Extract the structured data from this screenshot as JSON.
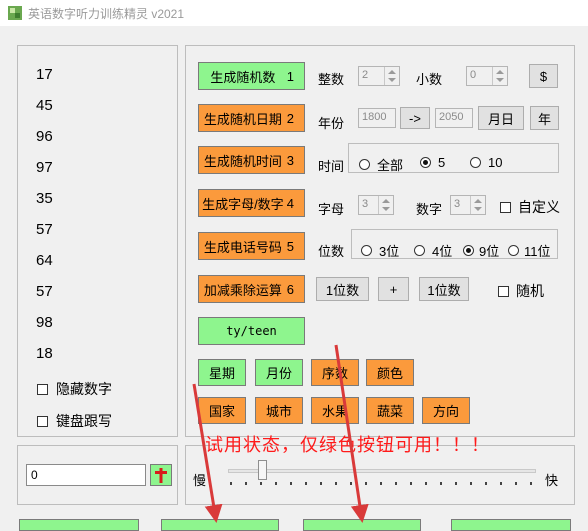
{
  "window": {
    "title": "英语数字听力训练精灵 v2021"
  },
  "numbers": [
    "17",
    "45",
    "96",
    "97",
    "35",
    "57",
    "64",
    "57",
    "98",
    "18"
  ],
  "left_options": {
    "hide_numbers": "隐藏数字",
    "keyboard_dictation": "键盘跟写"
  },
  "input_box": {
    "value": "0"
  },
  "buttons": {
    "random_number": {
      "label": "生成随机数",
      "num": "1"
    },
    "random_date": {
      "label": "生成随机日期",
      "num": "2"
    },
    "random_time": {
      "label": "生成随机时间",
      "num": "3"
    },
    "letter_digit": {
      "label": "生成字母/数字",
      "num": "4"
    },
    "phone_number": {
      "label": "生成电话号码",
      "num": "5"
    },
    "arithmetic": {
      "label": "加减乘除运算",
      "num": "6"
    },
    "ty_teen": {
      "label": "ty/teen"
    }
  },
  "row1": {
    "integer_label": "整数",
    "integer_value": "2",
    "decimal_label": "小数",
    "decimal_value": "0",
    "dollar": "$"
  },
  "row2": {
    "year_label": "年份",
    "year_from": "1800",
    "arrow": "->",
    "year_to": "2050",
    "month_day": "月日",
    "year": "年"
  },
  "row3": {
    "time_label": "时间",
    "options": [
      "全部",
      "5",
      "10"
    ],
    "selected": "5"
  },
  "row4": {
    "letter_label": "字母",
    "letter_value": "3",
    "digit_label": "数字",
    "digit_value": "3",
    "custom": "自定义"
  },
  "row5": {
    "digits_label": "位数",
    "options": [
      "3位",
      "4位",
      "9位",
      "11位"
    ],
    "selected": "9位"
  },
  "row6": {
    "operand1": "1位数",
    "operator": "+",
    "operand2": "1位数",
    "random": "随机"
  },
  "categories": [
    {
      "label": "星期",
      "color": "green"
    },
    {
      "label": "月份",
      "color": "green"
    },
    {
      "label": "序数",
      "color": "orange"
    },
    {
      "label": "颜色",
      "color": "orange"
    },
    {
      "label": "国家",
      "color": "orange"
    },
    {
      "label": "城市",
      "color": "orange"
    },
    {
      "label": "水果",
      "color": "orange"
    },
    {
      "label": "蔬菜",
      "color": "orange"
    },
    {
      "label": "方向",
      "color": "orange"
    }
  ],
  "trial_notice": "试用状态，仅绿色按钮可用！！！",
  "speed": {
    "slow": "慢",
    "fast": "快"
  },
  "colors": {
    "green": "#8ef58e",
    "orange": "#fb9a3c",
    "notice": "#ff1a1a",
    "arrow": "#d93a3a"
  }
}
